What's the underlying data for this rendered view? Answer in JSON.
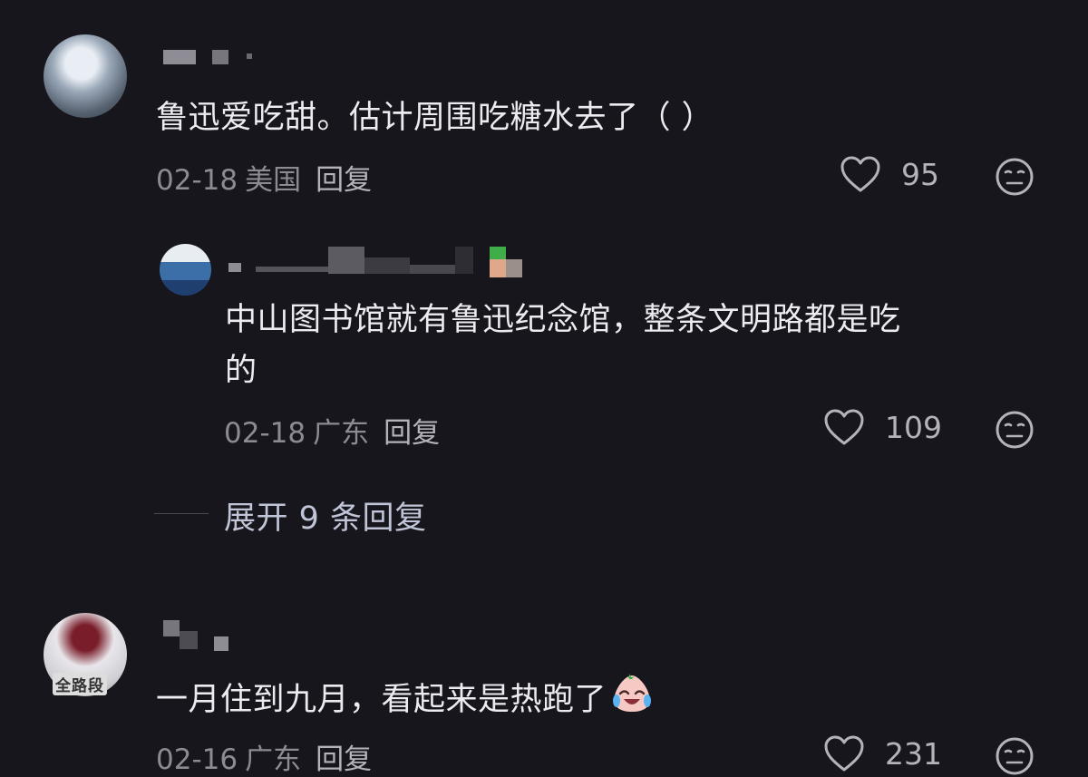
{
  "theme": {
    "background": "#17161c",
    "text": "#ecebf0",
    "meta": "#8c8b93",
    "meta_strong": "#b4b3ba",
    "accent": "#bfc4d6"
  },
  "comments": [
    {
      "text": "鲁迅爱吃甜。估计周围吃糖水去了（ ）",
      "date": "02-18",
      "region": "美国",
      "reply_label": "回复",
      "likes": "95",
      "like_icon": "heart-outline-icon",
      "dislike_icon": "neutral-face-icon"
    },
    {
      "text_line1": "中山图书馆就有鲁迅纪念馆，整条文明路都是吃",
      "text_line2": "的",
      "date": "02-18",
      "region": "广东",
      "reply_label": "回复",
      "likes": "109",
      "like_icon": "heart-outline-icon",
      "dislike_icon": "neutral-face-icon"
    },
    {
      "text": "一月住到九月，看起来是热跑了",
      "emoji": "crying-laughing-emoji",
      "avatar_text": "全路段",
      "date": "02-16",
      "region": "广东",
      "reply_label": "回复",
      "likes": "231",
      "like_icon": "heart-outline-icon",
      "dislike_icon": "neutral-face-icon"
    }
  ],
  "expand_replies": {
    "label": "展开 9 条回复"
  }
}
